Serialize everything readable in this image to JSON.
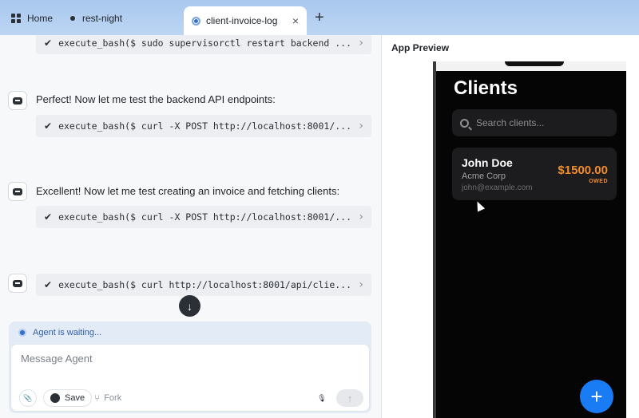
{
  "tabs": [
    {
      "label": "Home"
    },
    {
      "label": "rest-night"
    },
    {
      "label": "client-invoice-log",
      "close": "×"
    }
  ],
  "tab_add": "+",
  "chat": {
    "commands": [
      {
        "text": "execute_bash($ sudo supervisorctl restart backend ..."
      },
      {
        "text": "execute_bash($ curl -X POST http://localhost:8001/..."
      },
      {
        "text": "execute_bash($ curl -X POST http://localhost:8001/..."
      },
      {
        "text": "execute_bash($ curl http://localhost:8001/api/clie..."
      }
    ],
    "messages": [
      "Perfect! Now let me test the backend API endpoints:",
      "Excellent! Now let me test creating an invoice and fetching clients:"
    ],
    "check_glyph": "✔",
    "chevron_glyph": "›",
    "scroll_down": "↓"
  },
  "composer": {
    "status": "Agent is waiting...",
    "placeholder": "Message Agent",
    "save_label": "Save",
    "fork_label": "Fork",
    "attach_icon": "📎",
    "mic_icon": "🎙",
    "send_icon": "↑"
  },
  "preview": {
    "title": "App Preview",
    "app": {
      "heading": "Clients",
      "search_placeholder": "Search clients...",
      "clients": [
        {
          "name": "John Doe",
          "company": "Acme Corp",
          "email": "john@example.com",
          "amount": "$1500.00",
          "status": "OWED"
        }
      ],
      "fab": "+"
    }
  },
  "colors": {
    "accent": "#1a7cf5",
    "owed": "#f28c28"
  }
}
